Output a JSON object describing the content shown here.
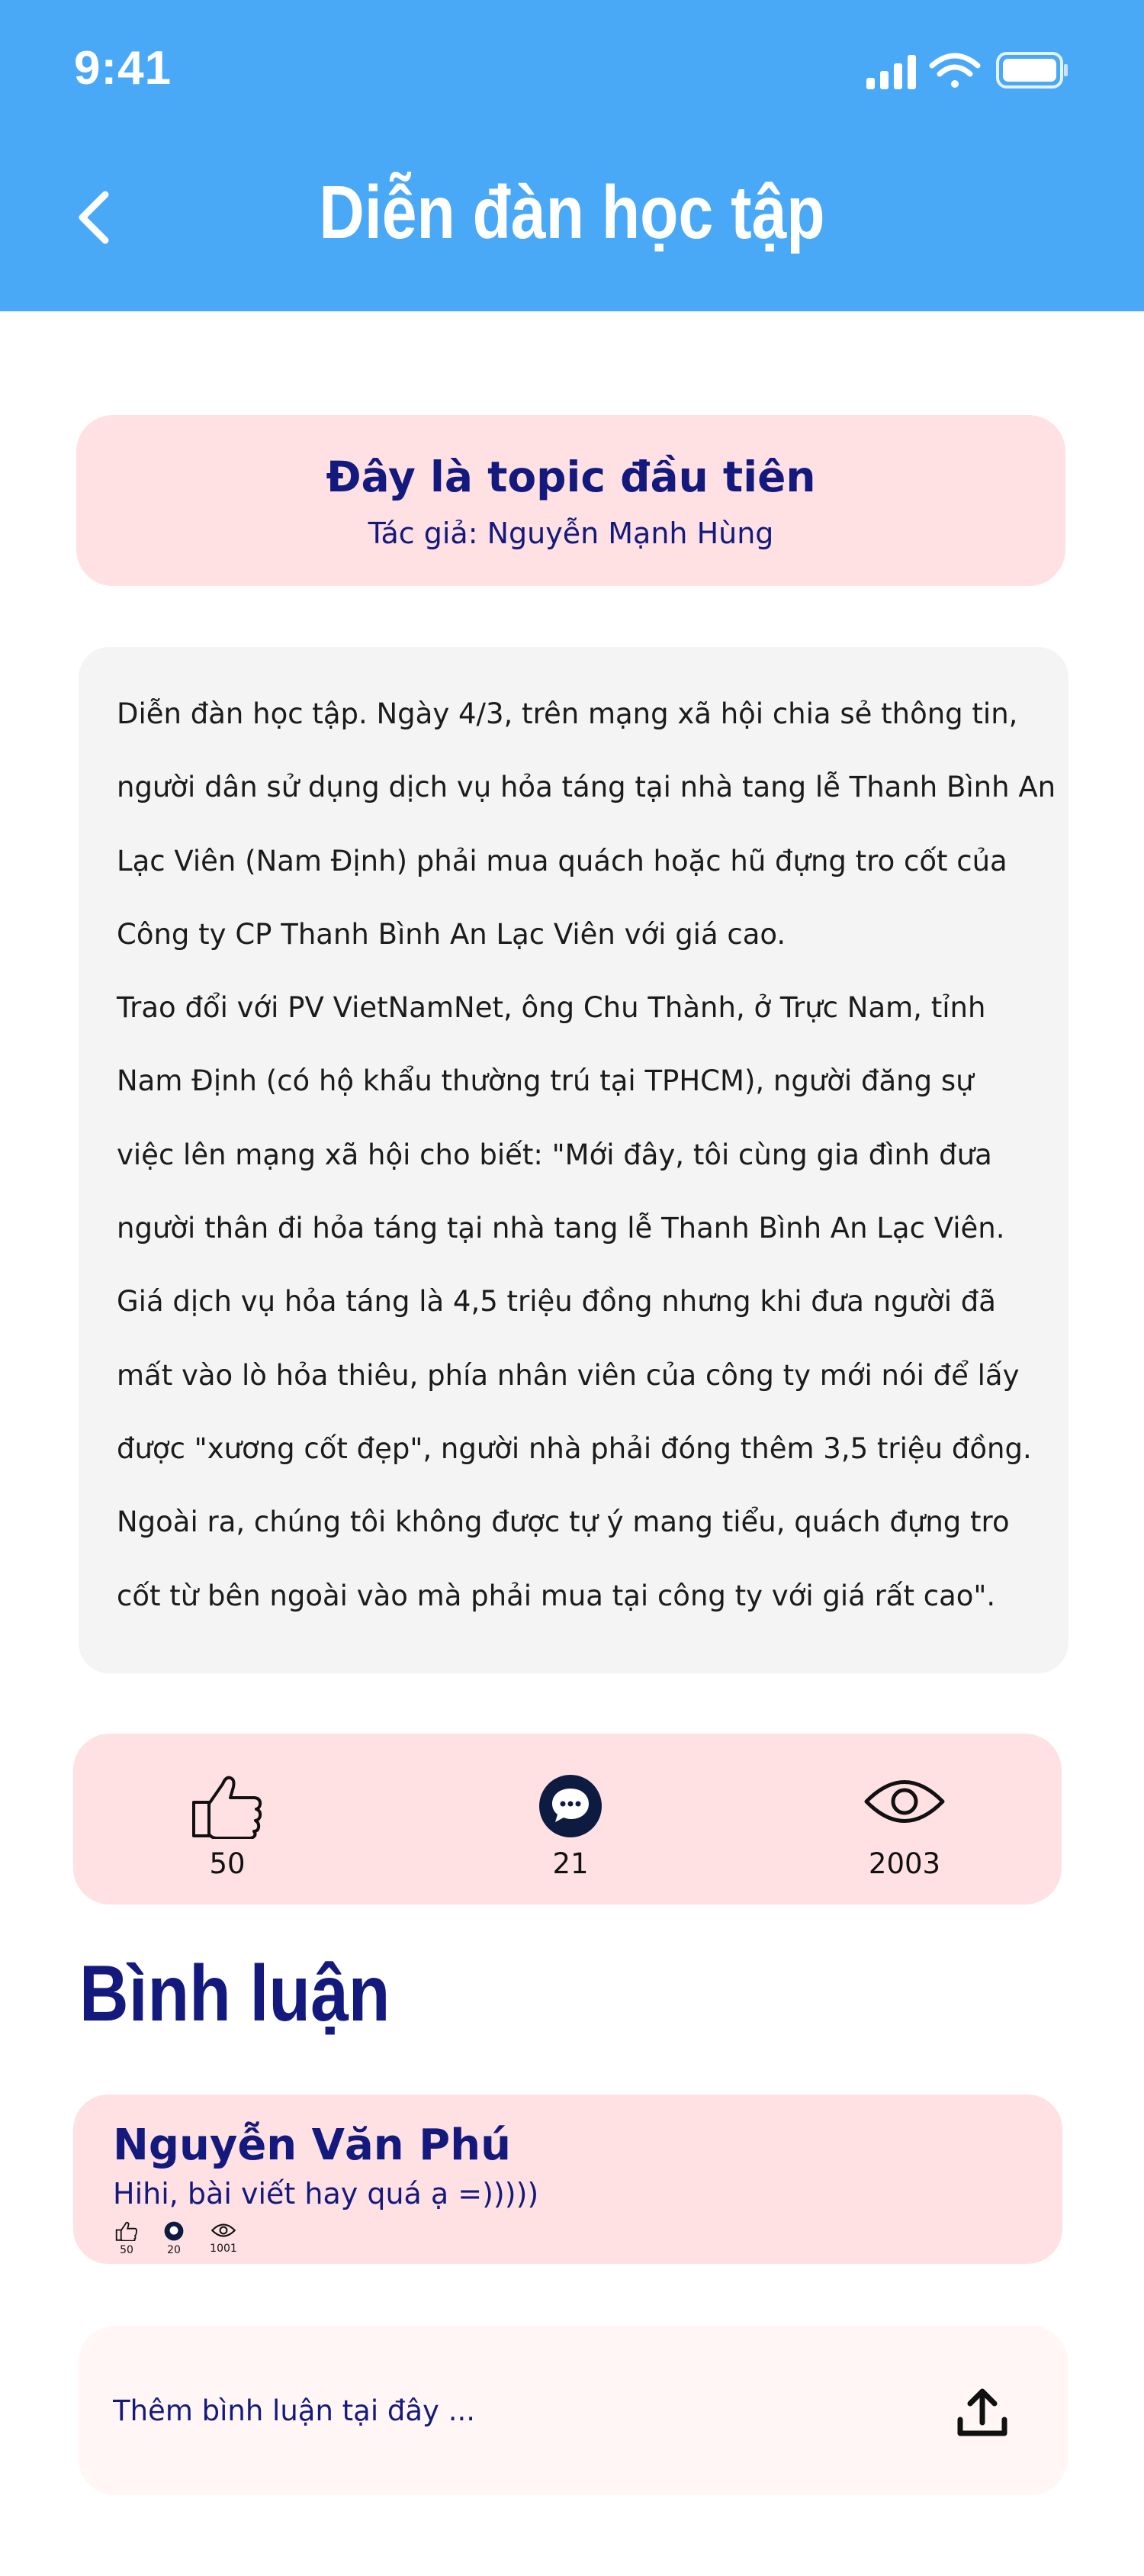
{
  "status_bar": {
    "time": "9:41"
  },
  "header": {
    "title": "Diễn đàn học tập",
    "back_icon": "chevron-left-icon"
  },
  "topic": {
    "title": "Đây là topic đầu tiên",
    "author": "Tác giả: Nguyễn Mạnh Hùng"
  },
  "content": {
    "lines": [
      "Diễn đàn học tập. Ngày 4/3, trên mạng xã hội chia sẻ thông tin,",
      "người dân sử dụng dịch vụ hỏa táng tại nhà tang lễ Thanh Bình An",
      "Lạc Viên (Nam Định) phải mua quách hoặc hũ đựng tro cốt của",
      "Công ty CP Thanh Bình An Lạc Viên với giá cao.",
      "Trao đổi với PV VietNamNet, ông Chu Thành, ở Trực Nam, tỉnh",
      "Nam Định (có hộ khẩu thường trú tại TPHCM), người đăng sự",
      "việc lên mạng xã hội cho biết: \"Mới đây, tôi cùng gia đình đưa",
      "người thân đi hỏa táng tại nhà tang lễ Thanh Bình An Lạc Viên.",
      "Giá dịch vụ hỏa táng là 4,5 triệu đồng nhưng khi đưa người đã",
      "mất vào lò hỏa thiêu, phía nhân viên của công ty mới nói để lấy",
      "được \"xương cốt đẹp\", người nhà phải đóng thêm 3,5 triệu đồng.",
      "Ngoài ra, chúng tôi không được tự ý mang tiểu, quách đựng tro",
      "cốt từ bên ngoài vào mà phải mua tại công ty với giá rất cao\"."
    ]
  },
  "stats": {
    "likes": "50",
    "comments": "21",
    "views": "2003"
  },
  "comments_section": {
    "heading": "Bình luận",
    "items": [
      {
        "author": "Nguyễn Văn Phú",
        "text": "Hihi, bài viết hay quá ạ =)))))",
        "likes": "50",
        "comments": "20",
        "views": "1001"
      }
    ]
  },
  "comment_input": {
    "placeholder": "Thêm bình luận tại đây ..."
  },
  "colors": {
    "header_bg": "#4aa9f7",
    "card_pink": "#ffe1e3",
    "navy": "#141a7d",
    "content_bg": "#f4f4f4"
  }
}
